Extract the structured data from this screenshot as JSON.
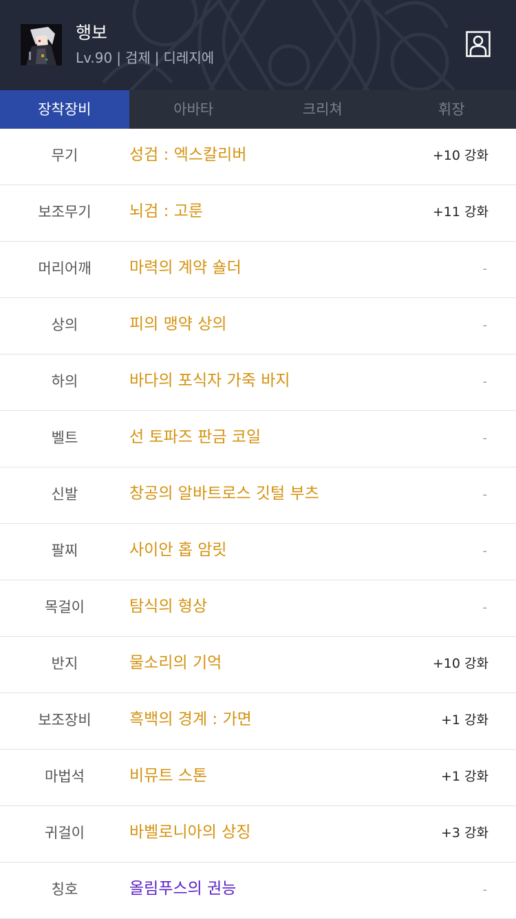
{
  "header": {
    "name": "행보",
    "level": "Lv.90",
    "class": "검제",
    "server": "디레지에",
    "separator": "|"
  },
  "tabs": [
    {
      "label": "장착장비",
      "active": true
    },
    {
      "label": "아바타",
      "active": false
    },
    {
      "label": "크리쳐",
      "active": false
    },
    {
      "label": "휘장",
      "active": false
    }
  ],
  "equipment": [
    {
      "slot": "무기",
      "item": "성검 : 엑스칼리버",
      "enhance": "+10 강화"
    },
    {
      "slot": "보조무기",
      "item": "뇌검 : 고룬",
      "enhance": "+11 강화"
    },
    {
      "slot": "머리어깨",
      "item": "마력의 계약 숄더",
      "enhance": "-"
    },
    {
      "slot": "상의",
      "item": "피의 맹약 상의",
      "enhance": "-"
    },
    {
      "slot": "하의",
      "item": "바다의 포식자 가죽 바지",
      "enhance": "-"
    },
    {
      "slot": "벨트",
      "item": "선 토파즈 판금 코일",
      "enhance": "-"
    },
    {
      "slot": "신발",
      "item": "창공의 알바트로스 깃털 부츠",
      "enhance": "-"
    },
    {
      "slot": "팔찌",
      "item": "사이안 홉 암릿",
      "enhance": "-"
    },
    {
      "slot": "목걸이",
      "item": "탐식의 형상",
      "enhance": "-"
    },
    {
      "slot": "반지",
      "item": "물소리의 기억",
      "enhance": "+10 강화"
    },
    {
      "slot": "보조장비",
      "item": "흑백의 경계 : 가면",
      "enhance": "+1 강화"
    },
    {
      "slot": "마법석",
      "item": "비뮤트 스톤",
      "enhance": "+1 강화"
    },
    {
      "slot": "귀걸이",
      "item": "바벨로니아의 상징",
      "enhance": "+3 강화"
    },
    {
      "slot": "칭호",
      "item": "올림푸스의 권능",
      "enhance": "-"
    }
  ],
  "icons": {
    "profile": "person-card-icon",
    "avatar": "character-portrait"
  },
  "colors": {
    "header_bg": "#232938",
    "tab_bar_bg": "#2a303b",
    "tab_active_bg": "#2b4aa7",
    "item_name": "#d4920f",
    "title_name": "#5a22c8"
  }
}
